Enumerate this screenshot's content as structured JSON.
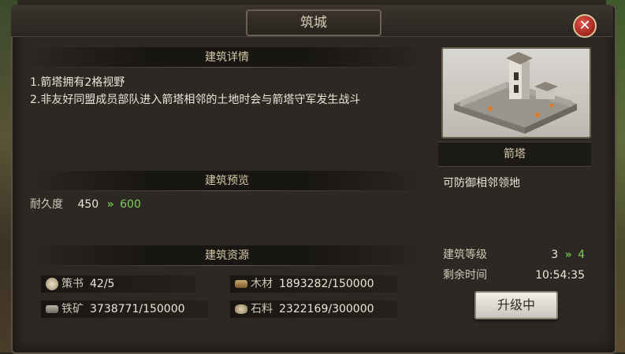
{
  "title": "筑城",
  "close_glyph": "✕",
  "sections": {
    "detail": {
      "heading": "建筑详情",
      "lines": [
        "1.箭塔拥有2格视野",
        "2.非友好同盟成员部队进入箭塔相邻的土地时会与箭塔守军发生战斗"
      ]
    },
    "preview": {
      "heading": "建筑预览",
      "label": "耐久度",
      "current": "450",
      "arrow": "»",
      "next": "600"
    },
    "resources": {
      "heading": "建筑资源",
      "items": [
        {
          "icon": "scroll-icon",
          "label": "策书",
          "value": "42/5"
        },
        {
          "icon": "wood-icon",
          "label": "木材",
          "value": "1893282/150000"
        },
        {
          "icon": "iron-icon",
          "label": "铁矿",
          "value": "3738771/150000"
        },
        {
          "icon": "stone-icon",
          "label": "石料",
          "value": "2322169/300000"
        }
      ]
    }
  },
  "building": {
    "name": "箭塔",
    "description": "可防御相邻领地",
    "level_label": "建筑等级",
    "level_current": "3",
    "level_arrow": "»",
    "level_next": "4",
    "time_label": "剩余时间",
    "time_value": "10:54:35",
    "button_label": "升级中"
  },
  "colors": {
    "accent_green": "#7fcf5e",
    "close_red": "#c0392b",
    "text_gold": "#d6c9a6"
  }
}
